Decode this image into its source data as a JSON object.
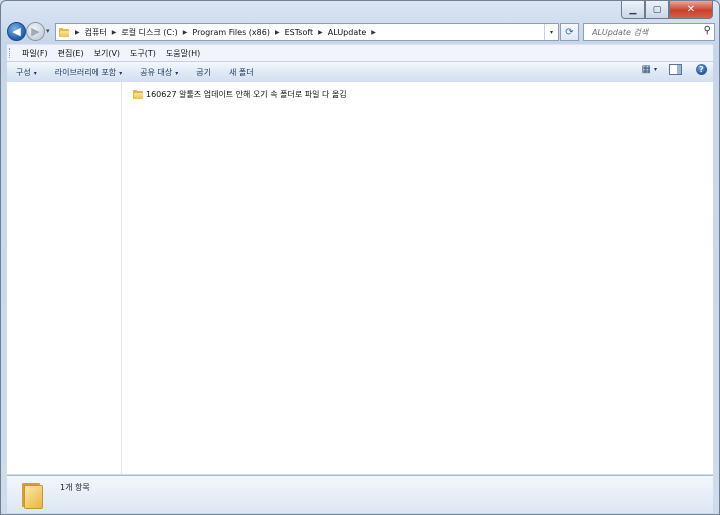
{
  "window": {
    "caption_buttons": {
      "minimize": "▁",
      "maximize": "▢",
      "close": "✕"
    }
  },
  "navigation": {
    "back_glyph": "◀",
    "forward_glyph": "▶",
    "recent_glyph": "▾"
  },
  "address": {
    "breadcrumbs": [
      "컴퓨터",
      "로컬 디스크 (C:)",
      "Program Files (x86)",
      "ESTsoft",
      "ALUpdate"
    ],
    "dropdown_glyph": "▾",
    "refresh_glyph": "⟳"
  },
  "search": {
    "placeholder": "ALUpdate 검색"
  },
  "menu": {
    "items": [
      "파일(F)",
      "편집(E)",
      "보기(V)",
      "도구(T)",
      "도움말(H)"
    ]
  },
  "commands": {
    "items": [
      {
        "label": "구성",
        "dropdown": "▾"
      },
      {
        "label": "라이브러리에 포함",
        "dropdown": "▾"
      },
      {
        "label": "공유 대상",
        "dropdown": "▾"
      },
      {
        "label": "굽기",
        "dropdown": ""
      },
      {
        "label": "새 폴더",
        "dropdown": ""
      }
    ],
    "views_dropdown": "▾",
    "help_glyph": "?"
  },
  "files": [
    {
      "name": "160627 알툴즈 업데이트 안해 오기 속 폴더로 파일 다 옮김",
      "icon": "folder-icon"
    }
  ],
  "details": {
    "item_count": "1개 항목"
  },
  "colors": {
    "frame": "#cfdcec",
    "accent": "#1f5ea8",
    "folder": "#f1c24e"
  }
}
